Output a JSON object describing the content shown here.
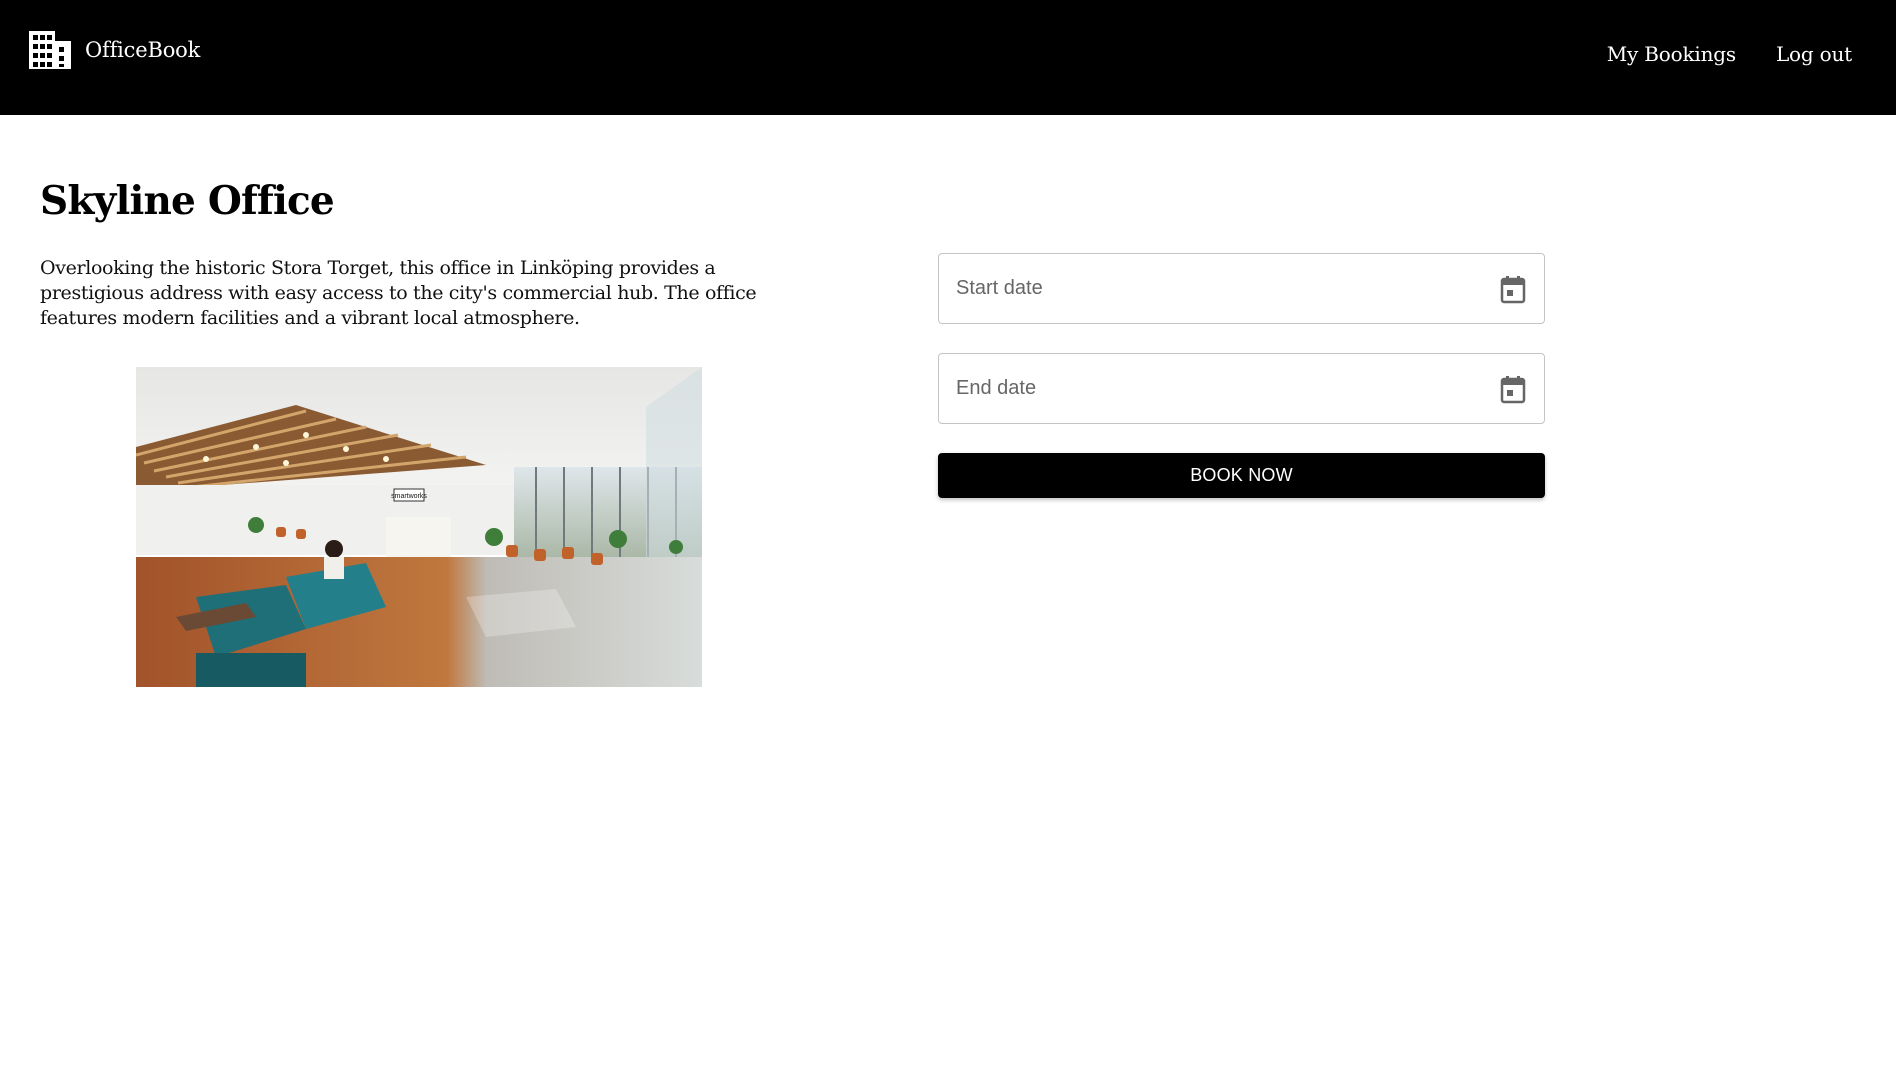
{
  "header": {
    "brand_name": "OfficeBook",
    "brand_icon": "office-building-icon",
    "nav": {
      "my_bookings": "My Bookings",
      "log_out": "Log out"
    }
  },
  "office": {
    "title": "Skyline Office",
    "description": "Overlooking the historic Stora Torget, this office in Linköping provides a prestigious address with easy access to the city's commercial hub. The office features modern facilities and a vibrant local atmosphere.",
    "photo_sign": "smartworks"
  },
  "booking": {
    "start_date_placeholder": "Start date",
    "end_date_placeholder": "End date",
    "calendar_icon": "calendar-icon",
    "book_button": "BOOK NOW"
  },
  "colors": {
    "header_bg": "#000000",
    "header_text": "#ffffff",
    "button_bg": "#000000",
    "button_text": "#ffffff",
    "field_border": "#c4c4c4",
    "placeholder_text": "#666666"
  }
}
